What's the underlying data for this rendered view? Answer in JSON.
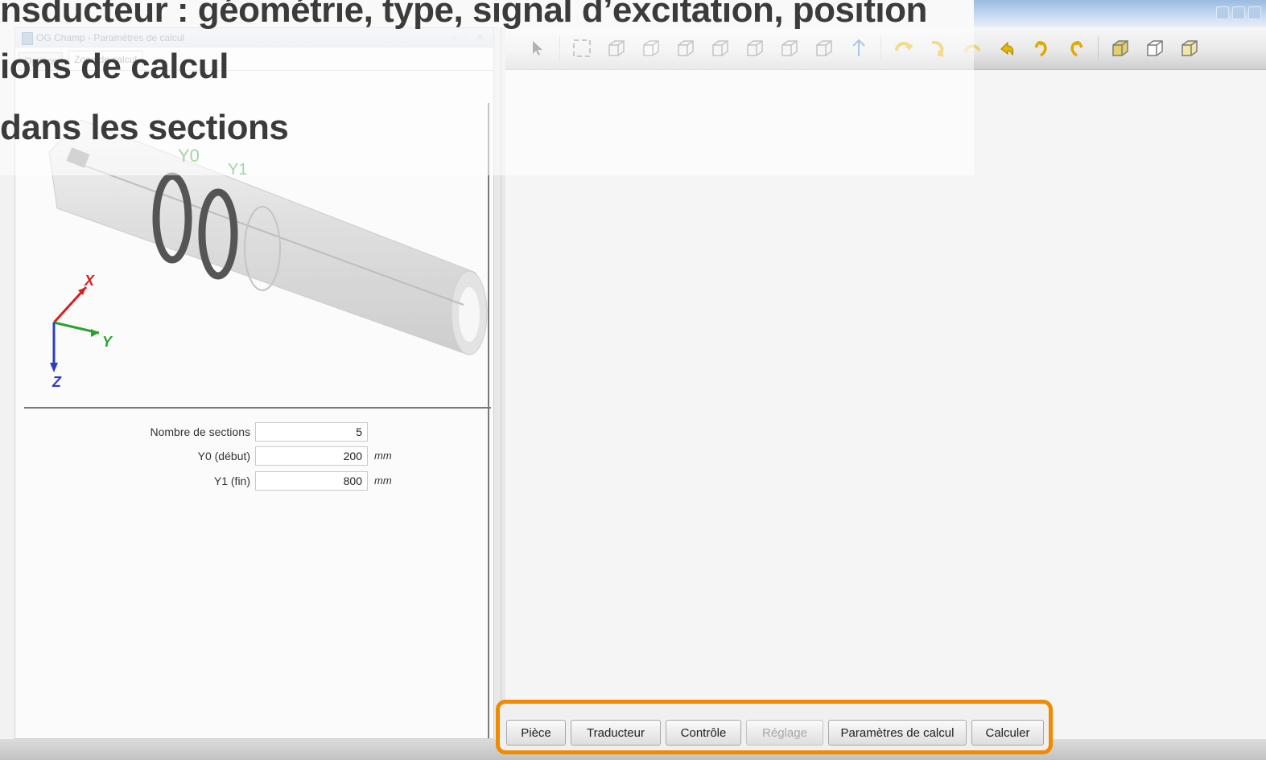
{
  "slide": {
    "line1": "nsducteur : géométrie, type, signal d’excitation, position",
    "line2": "ions de calcul",
    "line3": "dans les sections"
  },
  "dock": {
    "title": "OG Champ - Paramètres de calcul",
    "tabs": [
      {
        "label": "Options",
        "active": false
      },
      {
        "label": "Zone de calcul",
        "active": true
      }
    ]
  },
  "view3d": {
    "labels": {
      "y0": "Y0",
      "y1": "Y1"
    },
    "axes": {
      "x": "X",
      "y": "Y",
      "z": "Z"
    }
  },
  "form": {
    "sections": {
      "label": "Nombre de sections",
      "value": "5"
    },
    "y0": {
      "label": "Y0 (début)",
      "value": "200",
      "unit": "mm"
    },
    "y1": {
      "label": "Y1 (fin)",
      "value": "800",
      "unit": "mm"
    }
  },
  "buttons": {
    "piece": "Pièce",
    "traducteur": "Traducteur",
    "controle": "Contrôle",
    "reglage": "Réglage",
    "parametres": "Paramètres de calcul",
    "calculer": "Calculer"
  },
  "colors": {
    "highlight": "#f08a00",
    "axis_x": "#d62020",
    "axis_y": "#2fa02f",
    "axis_z": "#2d3dbf",
    "label_y": "#39a039"
  }
}
